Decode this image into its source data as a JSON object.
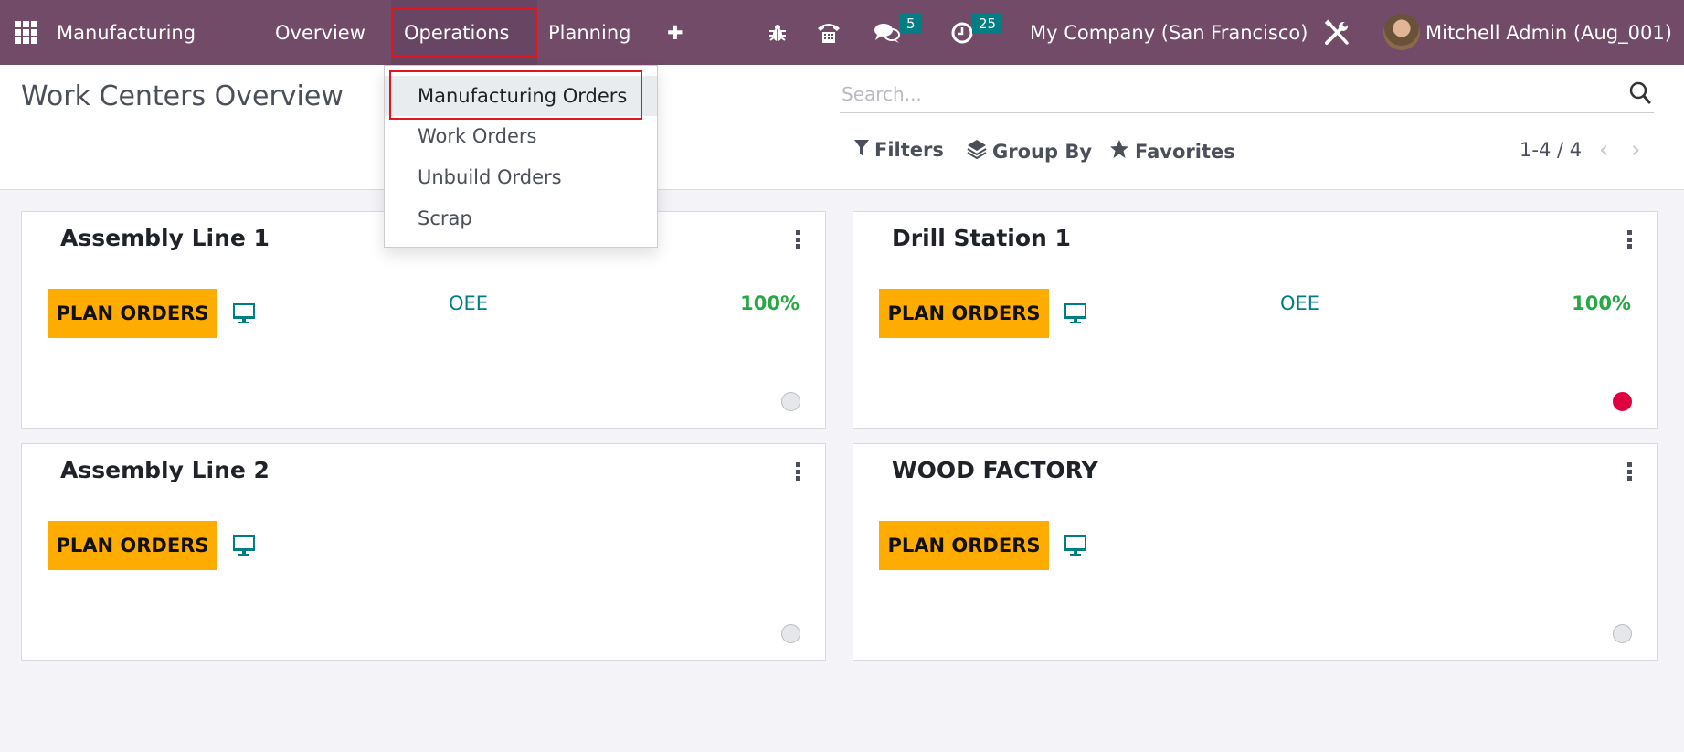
{
  "navbar": {
    "apps_icon": "grid-icon",
    "brand": "Manufacturing",
    "menus": [
      "Overview",
      "Operations",
      "Planning"
    ],
    "add_icon": "plus-icon",
    "plus_glyph": "✚",
    "systray": {
      "debug_icon": "bug-icon",
      "voip_icon": "phone-icon",
      "messages_icon": "chat-icon",
      "messages_count": "5",
      "activities_icon": "clock-icon",
      "activities_count": "25"
    },
    "company": "My Company (San Francisco)",
    "settings_icon": "tools-icon",
    "user": "Mitchell Admin (Aug_001)",
    "color": "#714b67"
  },
  "operations_menu": {
    "items": [
      {
        "label": "Manufacturing Orders",
        "active": true
      },
      {
        "label": "Work Orders",
        "active": false
      },
      {
        "label": "Unbuild Orders",
        "active": false
      },
      {
        "label": "Scrap",
        "active": false
      }
    ]
  },
  "control_panel": {
    "title": "Work Centers Overview",
    "search_placeholder": "Search...",
    "filters": "Filters",
    "group_by": "Group By",
    "favorites": "Favorites",
    "pager": "1-4 / 4"
  },
  "work_centers": [
    {
      "name": "Assembly Line 1",
      "button": "PLAN ORDERS",
      "oee_label": "OEE",
      "oee_value": "100%",
      "state": "normal"
    },
    {
      "name": "Drill Station 1",
      "button": "PLAN ORDERS",
      "oee_label": "OEE",
      "oee_value": "100%",
      "state": "blocked"
    },
    {
      "name": "Assembly Line 2",
      "button": "PLAN ORDERS",
      "oee_label": "",
      "oee_value": "",
      "state": "normal"
    },
    {
      "name": "WOOD FACTORY",
      "button": "PLAN ORDERS",
      "oee_label": "",
      "oee_value": "",
      "state": "normal"
    }
  ],
  "colors": {
    "accent": "#714b67",
    "plan_button": "#ffac00",
    "teal": "#017e84",
    "oee_green": "#28a745",
    "blocked_red": "#e00040",
    "highlight_box": "#e3141d"
  }
}
